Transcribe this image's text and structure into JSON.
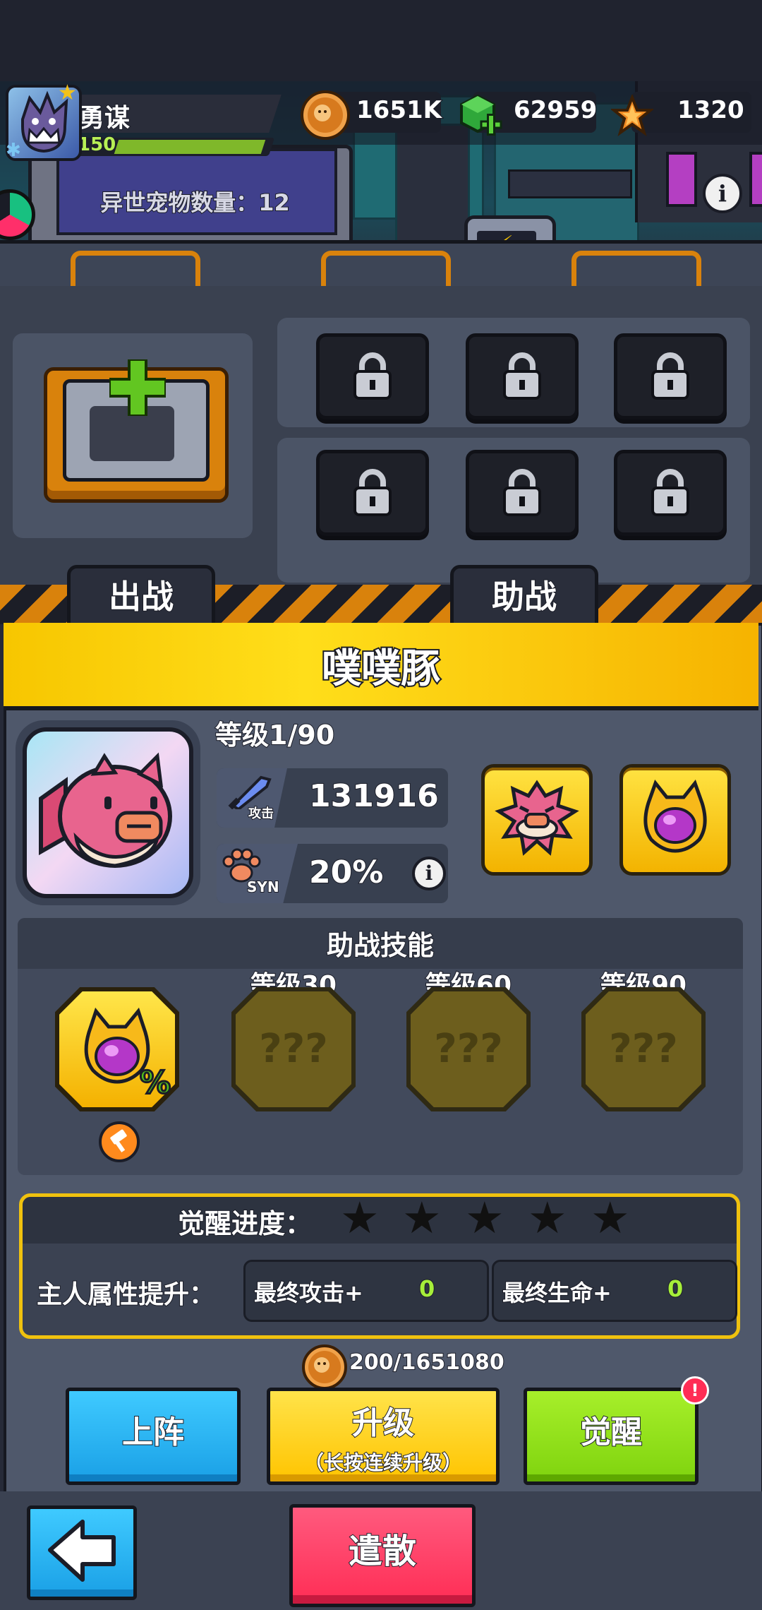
{
  "player": {
    "name": "勇谋",
    "level": "150"
  },
  "currencies": [
    {
      "icon": "coin-icon",
      "value": "1651K"
    },
    {
      "icon": "green-gem-plus-icon",
      "value": "62959"
    },
    {
      "icon": "orange-star-crystal-icon",
      "value": "1320"
    }
  ],
  "scene": {
    "pet_count_label": "异世宠物数量：12"
  },
  "tabs": {
    "battle": "出战",
    "assist": "助战"
  },
  "pet": {
    "name": "噗噗豚",
    "level_label": "等级1/90",
    "attack_tag": "攻击",
    "attack_value": "131916",
    "syn_tag": "SYN",
    "syn_value": "20%"
  },
  "assist_skills": {
    "header": "助战技能",
    "locked": [
      {
        "level_label": "等级30",
        "mark": "???"
      },
      {
        "level_label": "等级60",
        "mark": "???"
      },
      {
        "level_label": "等级90",
        "mark": "???"
      }
    ]
  },
  "awakening": {
    "progress_label": "觉醒进度：",
    "stars_filled": 0,
    "stars_total": 5,
    "owner_boost_label": "主人属性提升：",
    "final_attack_label": "最终攻击+",
    "final_attack_value": "0",
    "final_hp_label": "最终生命+",
    "final_hp_value": "0"
  },
  "cost": {
    "value": "200/1651080"
  },
  "buttons": {
    "deploy": "上阵",
    "upgrade": "升级",
    "upgrade_hint": "（长按连续升级）",
    "awaken": "觉醒",
    "dismiss": "遣散"
  },
  "colors": {
    "deploy": "#27b6f0",
    "upgrade": "#ffd21a",
    "awaken": "#8fe01a",
    "dismiss": "#ff3b63",
    "xp": "#7fb82a"
  }
}
